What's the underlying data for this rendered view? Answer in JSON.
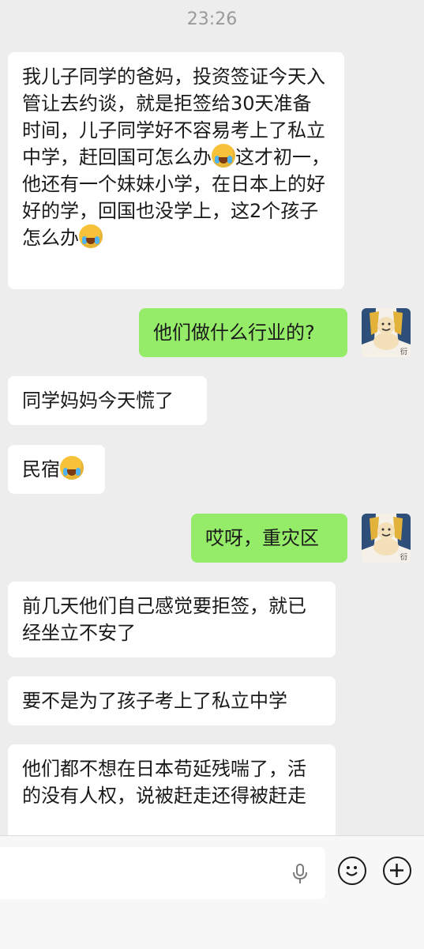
{
  "header": {
    "time": "23:26"
  },
  "messages": [
    {
      "side": "received",
      "text": "我儿子同学的爸妈，投资签证今天入管让去约谈，就是拒签给30天准备时间，儿子同学好不容易考上了私立中学，赶回国可怎么办",
      "emoji1": "facepalm-emoji",
      "text2": "这才初一，他还有一个妹妹小学，在日本上的好好的学，回国也没学上，这2个孩子怎么办",
      "emoji2": "facepalm-emoji"
    },
    {
      "side": "sent",
      "text": "他们做什么行业的?"
    },
    {
      "side": "received",
      "text": "同学妈妈今天慌了"
    },
    {
      "side": "received",
      "text": "民宿",
      "emoji": "crying-emoji"
    },
    {
      "side": "sent",
      "text": "哎呀，重灾区"
    },
    {
      "side": "received",
      "text": "前几天他们自己感觉要拒签，就已经坐立不安了"
    },
    {
      "side": "received",
      "text": "要不是为了孩子考上了私立中学"
    },
    {
      "side": "received",
      "text": "他们都不想在日本苟延残喘了，活的没有人权，说被赶走还得被赶走"
    }
  ],
  "avatar": {
    "caption": "衍"
  },
  "input": {
    "value": "",
    "voice_icon": "microphone-icon",
    "emoji_icon": "smiley-icon",
    "more_icon": "plus-icon"
  },
  "colors": {
    "background": "#ededed",
    "received_bubble": "#ffffff",
    "sent_bubble": "#95ec69"
  }
}
